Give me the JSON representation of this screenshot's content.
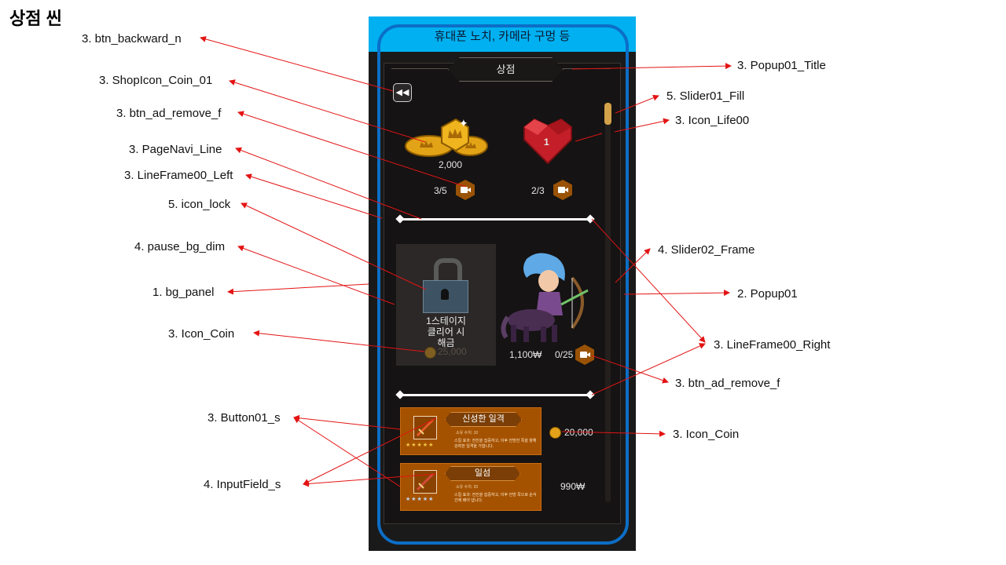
{
  "title": "상점 씬",
  "device": {
    "notch_text": "휴대폰 노치, 카메라 구멍 등"
  },
  "popup": {
    "title": "상점",
    "back_icon": "double-chevron-left",
    "slider_fill_level": 0.06,
    "shop_top": {
      "coin_amount": "2,000",
      "coin_ad_count": "3/5",
      "life_value": "1",
      "life_ad_count": "2/3"
    },
    "character": {
      "lock_text": "1스테이지\n클리어 시\n해금",
      "locked_price": "25,000",
      "price": "1,100₩",
      "ad_count": "0/25"
    },
    "items": [
      {
        "name": "신성한 일격",
        "sub": "소유 수치: 10",
        "desc": "스킬 효과: 전진을 집중하고, 이후 전방한 쪽을 향해 강력한 일격을 가합니다.",
        "stars": "★★★★★",
        "price": "20,000",
        "price_icon": "coin-icon"
      },
      {
        "name": "일섬",
        "sub": "소유 수치: 20",
        "desc": "스킬 효과: 전진을 집중하고, 이후 전방 쪽으로 순식간에 베어 냅니다.",
        "stars": "★★★★★",
        "price": "990₩",
        "price_icon": ""
      }
    ]
  },
  "callouts": [
    "3. btn_backward_n",
    "3. ShopIcon_Coin_01",
    "3. btn_ad_remove_f",
    "3. PageNavi_Line",
    "3. LineFrame00_Left",
    "5. icon_lock",
    "4. pause_bg_dim",
    "1. bg_panel",
    "3. Icon_Coin",
    "3. Button01_s",
    "4. InputField_s",
    "3. Popup01_Title",
    "5. Slider01_Fill",
    "3. Icon_Life00",
    "4. Slider02_Frame",
    "2. Popup01",
    "3. LineFrame00_Right",
    "3. btn_ad_remove_f",
    "3. Icon_Coin"
  ],
  "colors": {
    "notch": "#00b0f0",
    "device_outline": "#0c6ec6",
    "phone_bg": "#1b1a1a",
    "arrow": "#e31414",
    "item_card": "#a55200",
    "ad_button": "#9a5206"
  }
}
